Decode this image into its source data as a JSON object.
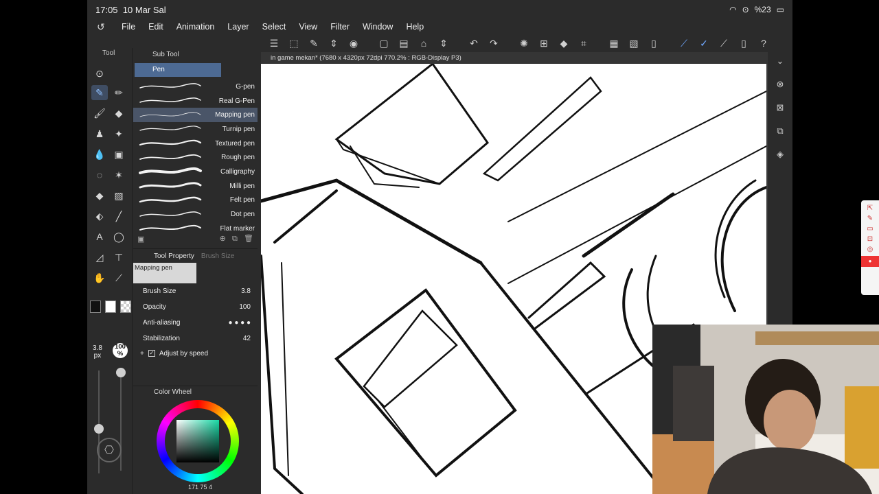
{
  "status_bar": {
    "time": "17:05",
    "date": "10 Mar Sal",
    "battery": "%23"
  },
  "menu": {
    "items": [
      "File",
      "Edit",
      "Animation",
      "Layer",
      "Select",
      "View",
      "Filter",
      "Window",
      "Help"
    ]
  },
  "tool_panel": {
    "tab_label": "Tool",
    "brush_size": "3.8",
    "brush_unit": "px",
    "opacity_value": "100",
    "opacity_unit": "%",
    "vertical_label": "Tool"
  },
  "sub_tool": {
    "header": "Sub Tool",
    "group": "Pen",
    "brushes": [
      {
        "name": "G-pen"
      },
      {
        "name": "Real G-Pen"
      },
      {
        "name": "Mapping pen"
      },
      {
        "name": "Turnip pen"
      },
      {
        "name": "Textured pen"
      },
      {
        "name": "Rough pen"
      },
      {
        "name": "Calligraphy"
      },
      {
        "name": "Milli pen"
      },
      {
        "name": "Felt pen"
      },
      {
        "name": "Dot pen"
      },
      {
        "name": "Flat marker"
      }
    ],
    "selected_index": 2
  },
  "tool_property": {
    "tab_label": "Tool Property",
    "tab_inactive": "Brush Size",
    "preview_label": "Mapping pen",
    "brush_size_label": "Brush Size",
    "brush_size_value": "3.8",
    "opacity_label": "Opacity",
    "opacity_value": "100",
    "antialiasing_label": "Anti-aliasing",
    "stabilization_label": "Stabilization",
    "stabilization_value": "42",
    "adjust_label": "Adjust by speed"
  },
  "color_wheel": {
    "title": "Color Wheel",
    "readout": "171 75 4",
    "current_color": "#19d9a6"
  },
  "document": {
    "title": "in game mekan* (7680 x 4320px 72dpi 770.2% : RGB-Display P3)"
  },
  "colors": {
    "accent": "#4d6a93",
    "selection": "#4a5568",
    "record": "#e33333"
  }
}
